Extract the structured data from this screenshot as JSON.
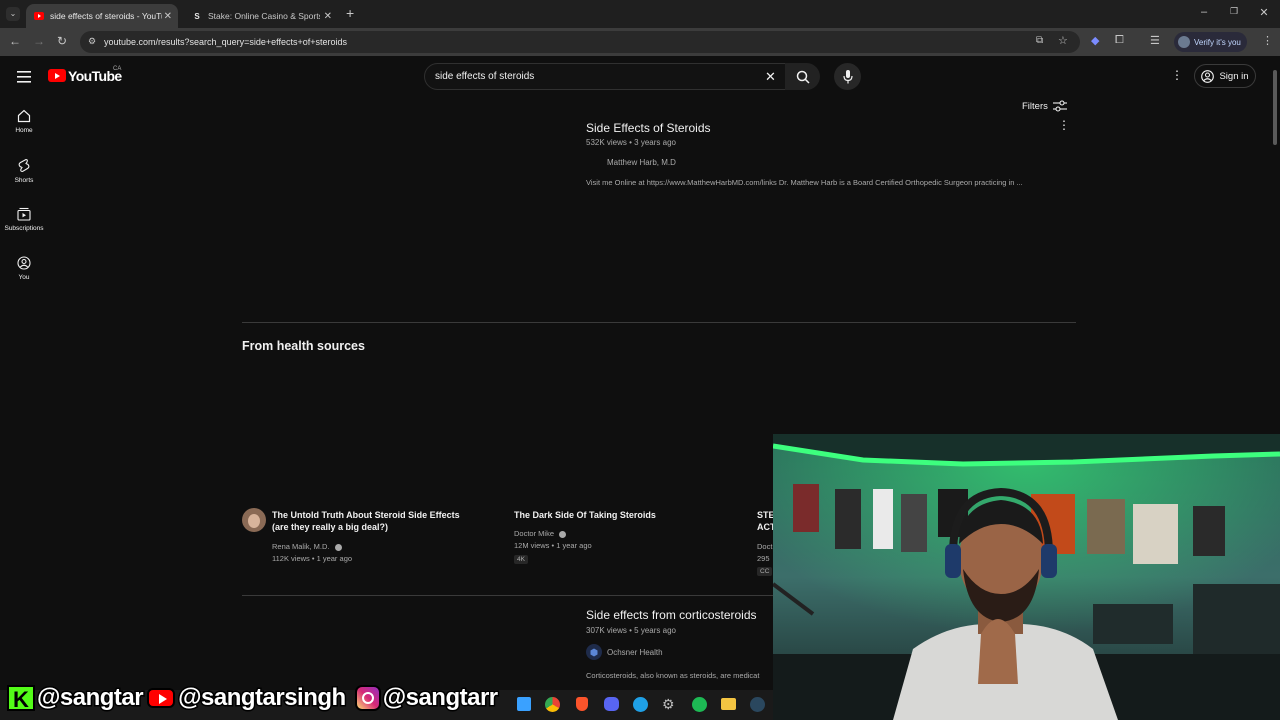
{
  "browser": {
    "tabs": [
      {
        "title": "side effects of steroids - YouTube",
        "active": true
      },
      {
        "title": "Stake: Online Casino & Sports B",
        "active": false
      }
    ],
    "new_tab": "+",
    "url": "youtube.com/results?search_query=side+effects+of+steroids",
    "verify_label": "Verify it's you"
  },
  "youtube": {
    "logo_text": "YouTube",
    "country": "CA",
    "search_value": "side effects of steroids",
    "sign_in": "Sign in",
    "filters": "Filters",
    "guide": [
      {
        "label": "Home",
        "icon": "home-icon"
      },
      {
        "label": "Shorts",
        "icon": "shorts-icon"
      },
      {
        "label": "Subscriptions",
        "icon": "subscriptions-icon"
      },
      {
        "label": "You",
        "icon": "you-icon"
      }
    ],
    "results": [
      {
        "title": "Side Effects of Steroids",
        "views": "532K views",
        "age": "3 years ago",
        "channel": "Matthew Harb, M.D",
        "description": "Visit me Online at https://www.MatthewHarbMD.com/links Dr. Matthew Harb is a Board Certified Orthopedic Surgeon practicing in ..."
      },
      {
        "title": "Side effects from corticosteroids",
        "views": "307K views",
        "age": "5 years ago",
        "channel": "Ochsner Health",
        "description": "Corticosteroids, also known as steroids, are medicat"
      }
    ],
    "shelf": {
      "heading": "From health sources",
      "items": [
        {
          "title_1": "The Untold Truth About Steroid Side Effects",
          "title_2": "(are they really a big deal?)",
          "channel": "Rena Malik, M.D.",
          "meta": "112K views • 1 year ago"
        },
        {
          "title_1": "The Dark Side Of Taking Steroids",
          "channel": "Doctor Mike",
          "meta": "12M views • 1 year ago",
          "badge": "4K"
        },
        {
          "title_1": "STE",
          "title_2": "ACT",
          "channel": "Doct",
          "meta": "295",
          "badge": "CC"
        }
      ]
    }
  },
  "overlay": {
    "kick_handle": "@sangtar",
    "youtube_handle": "@sangtarsingh",
    "instagram_handle": "@sangtarr"
  },
  "colors": {
    "background": "#0f0f0f",
    "youtube_red": "#ff0000",
    "kick_green": "#53fc18",
    "webcam_neon": "#35ff7a"
  }
}
